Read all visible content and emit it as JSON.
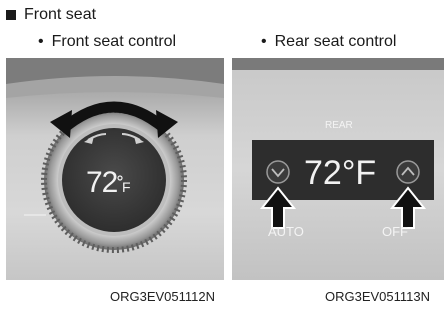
{
  "section_title": "Front seat",
  "left": {
    "caption": "Front seat control",
    "display_value": "72",
    "display_unit": "F",
    "image_code": "ORG3EV051112N"
  },
  "right": {
    "caption": "Rear seat control",
    "panel_label": "REAR",
    "display_value": "72°F",
    "left_button_label": "AUTO",
    "right_button_label": "OFF",
    "image_code": "ORG3EV051113N"
  }
}
